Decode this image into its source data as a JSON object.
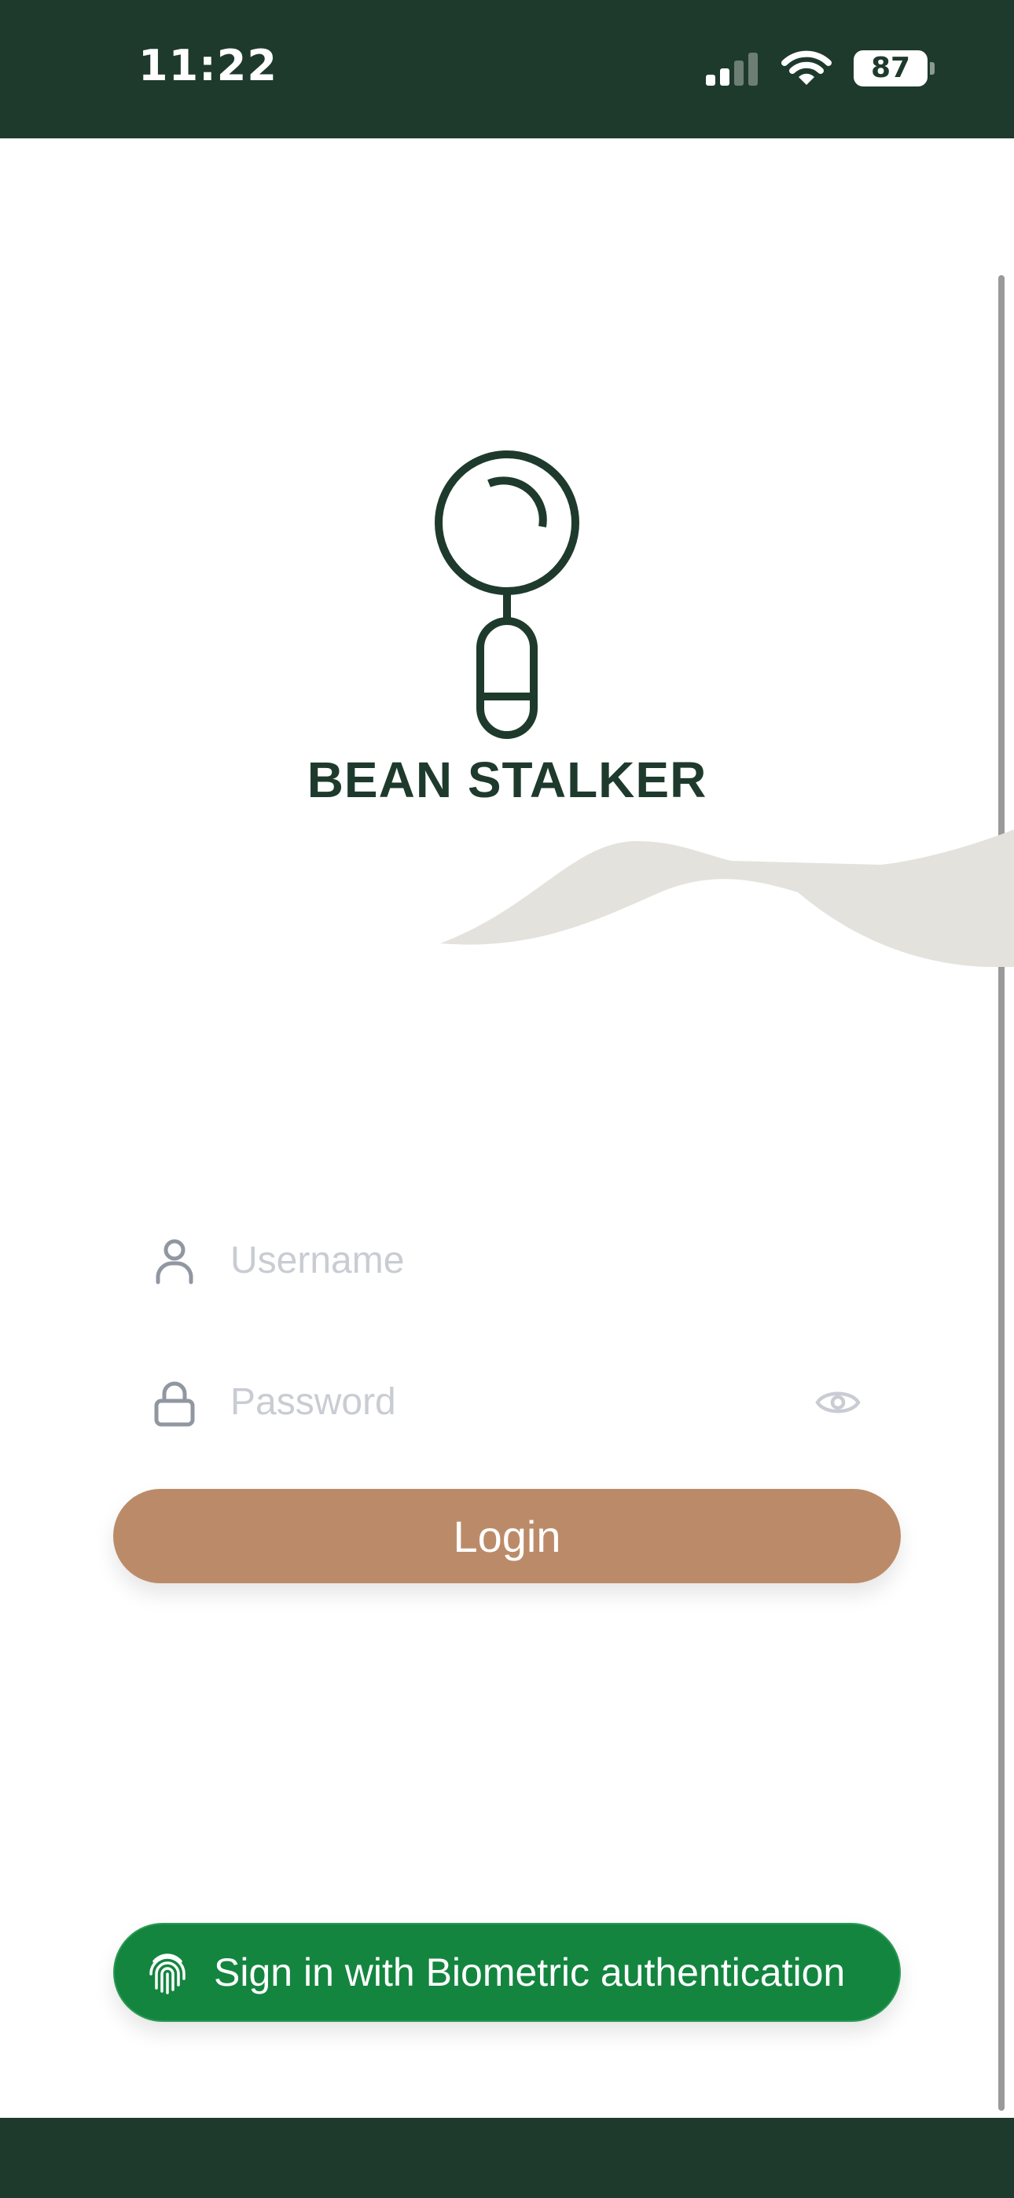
{
  "status_bar": {
    "time": "11:22",
    "battery_level": "87",
    "signal_bars_active": 2,
    "signal_bars_total": 4
  },
  "brand": {
    "name": "BEAN STALKER",
    "logo_icon": "coffee-tamper-icon"
  },
  "form": {
    "username": {
      "placeholder": "Username",
      "value": "",
      "icon": "user-icon"
    },
    "password": {
      "placeholder": "Password",
      "value": "",
      "icon": "lock-icon",
      "toggle_icon": "eye-icon"
    },
    "login_label": "Login",
    "biometric_label": "Sign in with Biometric authentication",
    "biometric_icon": "fingerprint-icon"
  },
  "colors": {
    "primary_dark": "#1e3a2c",
    "login_button": "#bb8b69",
    "biometric_button": "#13853f",
    "wave": "#e4e2dd",
    "placeholder": "#c9ccd3"
  }
}
